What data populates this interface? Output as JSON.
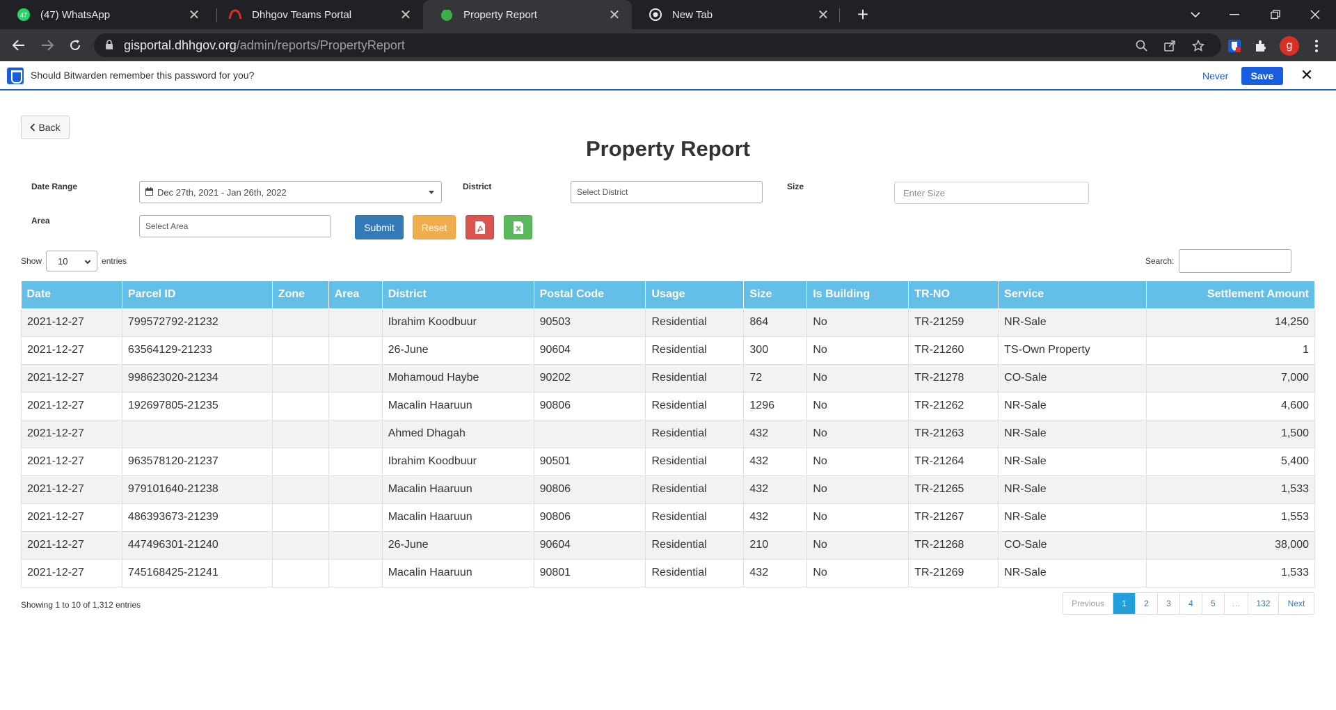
{
  "browser": {
    "tabs": [
      {
        "title": "(47) WhatsApp",
        "badge": "47"
      },
      {
        "title": "Dhhgov Teams Portal"
      },
      {
        "title": "Property Report"
      },
      {
        "title": "New Tab"
      }
    ],
    "url_host": "gisportal.dhhgov.org",
    "url_path": "/admin/reports/PropertyReport",
    "avatar_letter": "g"
  },
  "bitwarden": {
    "message": "Should Bitwarden remember this password for you?",
    "never_label": "Never",
    "save_label": "Save"
  },
  "page": {
    "back_label": "Back",
    "title": "Property Report"
  },
  "filters": {
    "date_range_label": "Date Range",
    "date_range_value": "Dec 27th, 2021 - Jan 26th, 2022",
    "district_label": "District",
    "district_placeholder": "Select District",
    "size_label": "Size",
    "size_placeholder": "Enter Size",
    "area_label": "Area",
    "area_placeholder": "Select Area",
    "submit_label": "Submit",
    "reset_label": "Reset"
  },
  "table_controls": {
    "show_label": "Show",
    "page_size": "10",
    "entries_label": "entries",
    "search_label": "Search:"
  },
  "table": {
    "columns": [
      "Date",
      "Parcel ID",
      "Zone",
      "Area",
      "District",
      "Postal Code",
      "Usage",
      "Size",
      "Is Building",
      "TR-NO",
      "Service",
      "Settlement Amount"
    ],
    "rows": [
      [
        "2021-12-27",
        "799572792-21232",
        "",
        "",
        "Ibrahim Koodbuur",
        "90503",
        "Residential",
        "864",
        "No",
        "TR-21259",
        "NR-Sale",
        "14,250"
      ],
      [
        "2021-12-27",
        "63564129-21233",
        "",
        "",
        "26-June",
        "90604",
        "Residential",
        "300",
        "No",
        "TR-21260",
        "TS-Own Property",
        "1"
      ],
      [
        "2021-12-27",
        "998623020-21234",
        "",
        "",
        "Mohamoud Haybe",
        "90202",
        "Residential",
        "72",
        "No",
        "TR-21278",
        "CO-Sale",
        "7,000"
      ],
      [
        "2021-12-27",
        "192697805-21235",
        "",
        "",
        "Macalin Haaruun",
        "90806",
        "Residential",
        "1296",
        "No",
        "TR-21262",
        "NR-Sale",
        "4,600"
      ],
      [
        "2021-12-27",
        "",
        "",
        "",
        "Ahmed Dhagah",
        "",
        "Residential",
        "432",
        "No",
        "TR-21263",
        "NR-Sale",
        "1,500"
      ],
      [
        "2021-12-27",
        "963578120-21237",
        "",
        "",
        "Ibrahim Koodbuur",
        "90501",
        "Residential",
        "432",
        "No",
        "TR-21264",
        "NR-Sale",
        "5,400"
      ],
      [
        "2021-12-27",
        "979101640-21238",
        "",
        "",
        "Macalin Haaruun",
        "90806",
        "Residential",
        "432",
        "No",
        "TR-21265",
        "NR-Sale",
        "1,533"
      ],
      [
        "2021-12-27",
        "486393673-21239",
        "",
        "",
        "Macalin Haaruun",
        "90806",
        "Residential",
        "432",
        "No",
        "TR-21267",
        "NR-Sale",
        "1,553"
      ],
      [
        "2021-12-27",
        "447496301-21240",
        "",
        "",
        "26-June",
        "90604",
        "Residential",
        "210",
        "No",
        "TR-21268",
        "CO-Sale",
        "38,000"
      ],
      [
        "2021-12-27",
        "745168425-21241",
        "",
        "",
        "Macalin Haaruun",
        "90801",
        "Residential",
        "432",
        "No",
        "TR-21269",
        "NR-Sale",
        "1,533"
      ]
    ]
  },
  "footer": {
    "info": "Showing 1 to 10 of 1,312 entries",
    "pagination": [
      "Previous",
      "1",
      "2",
      "3",
      "4",
      "5",
      "…",
      "132",
      "Next"
    ],
    "active_page": "1"
  },
  "colors": {
    "header_bg": "#64bfe8",
    "submit": "#337ab7",
    "reset": "#f0ad4e",
    "pdf": "#d9534f",
    "excel": "#5cb85c",
    "bitwarden": "#175ddc"
  },
  "icons": [
    "whatsapp-icon",
    "teams-icon",
    "property-report-icon",
    "chrome-icon",
    "lock-icon",
    "zoom-icon",
    "share-icon",
    "star-icon",
    "bitwarden-icon",
    "extensions-icon",
    "menu-icon",
    "calendar-icon",
    "pdf-icon",
    "excel-icon"
  ]
}
